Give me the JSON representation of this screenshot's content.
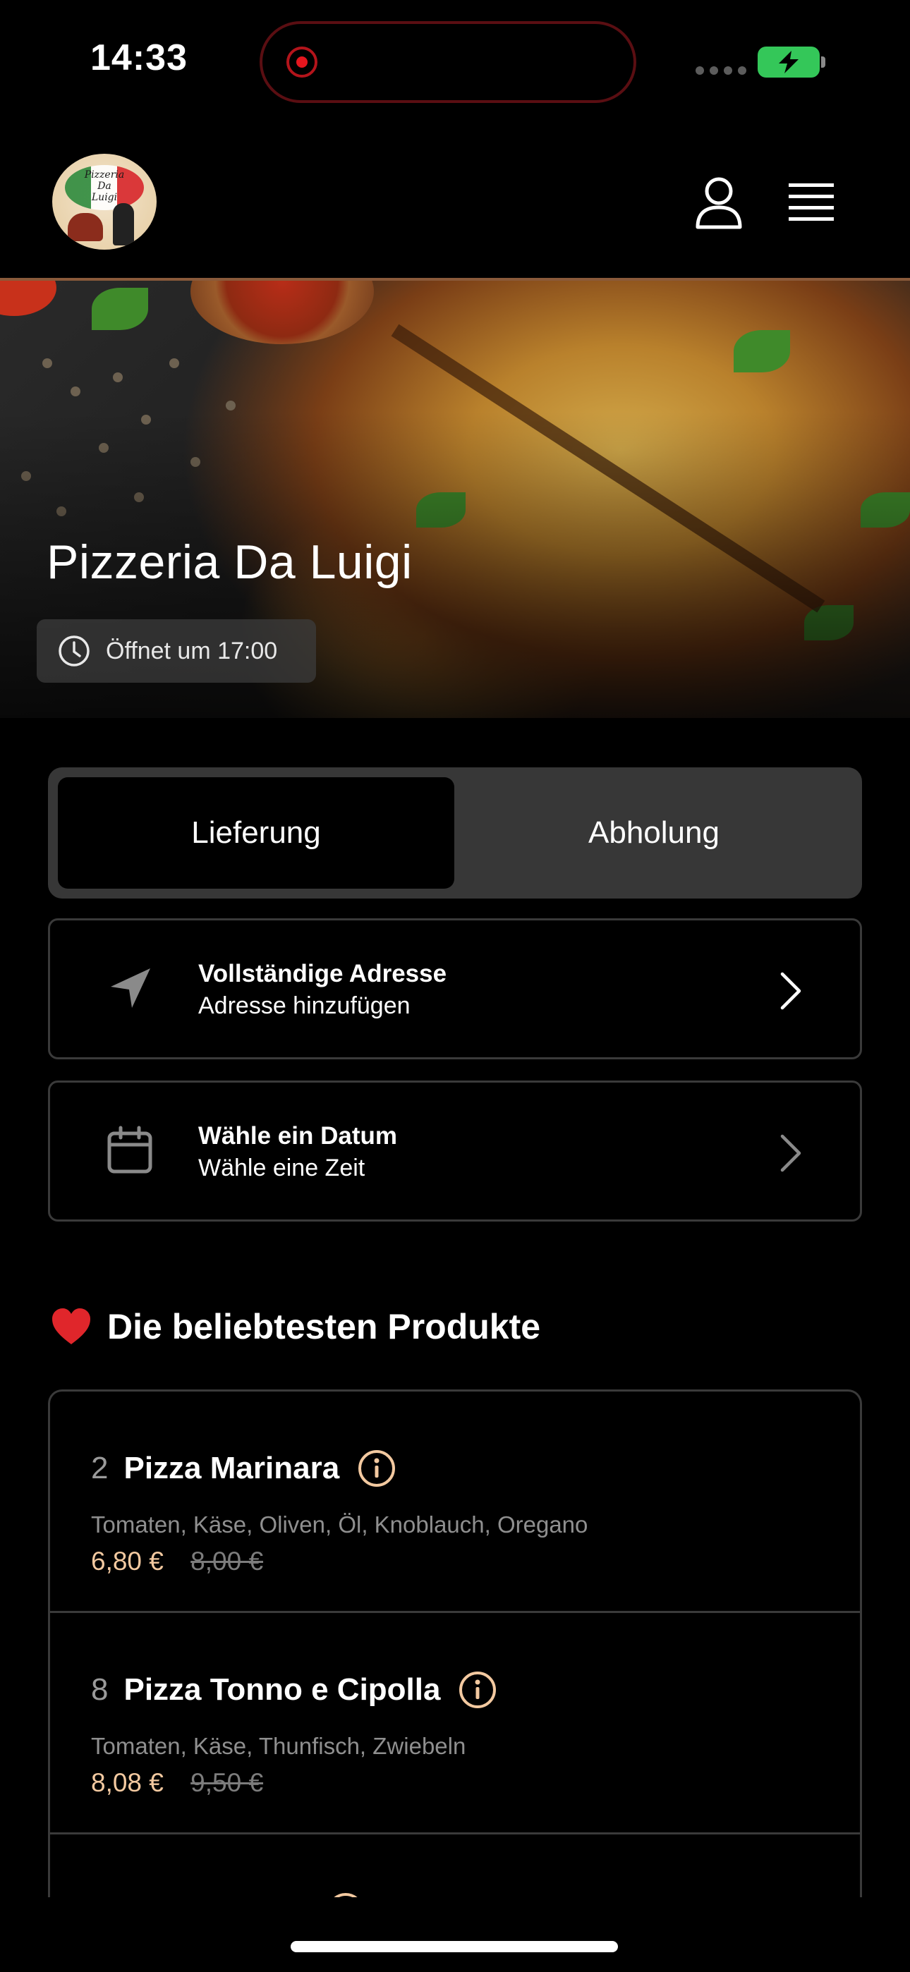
{
  "status_bar": {
    "time": "14:33"
  },
  "header": {
    "logo_text": [
      "Pizzeria",
      "Da",
      "Luigi"
    ],
    "profile_icon": "user-icon",
    "menu_icon": "hamburger-menu-icon"
  },
  "hero": {
    "restaurant_name": "Pizzeria Da Luigi",
    "open_status": "Öffnet um 17:00"
  },
  "order_mode": {
    "tabs": [
      {
        "label": "Lieferung",
        "selected": true
      },
      {
        "label": "Abholung",
        "selected": false
      }
    ]
  },
  "options": {
    "address": {
      "title": "Vollständige Adresse",
      "subtitle": "Adresse hinzufügen",
      "icon": "location-arrow-icon"
    },
    "date": {
      "title": "Wähle ein Datum",
      "subtitle": "Wähle eine Zeit",
      "icon": "calendar-icon"
    }
  },
  "popular": {
    "heading": "Die beliebtesten Produkte",
    "products": [
      {
        "number": "2",
        "name": "Pizza Marinara",
        "description": "Tomaten, Käse, Oliven, Öl, Knoblauch, Oregano",
        "price": "6,80 €",
        "old_price": "8,00 €"
      },
      {
        "number": "8",
        "name": "Pizza Tonno e Cipolla",
        "description": "Tomaten, Käse, Thunfisch, Zwiebeln",
        "price": "8,08 €",
        "old_price": "9,50 €"
      }
    ]
  },
  "colors": {
    "background": "#000000",
    "accent_price": "#f3c9a0",
    "border": "#3a3a3a",
    "tab_bg": "#373737"
  }
}
